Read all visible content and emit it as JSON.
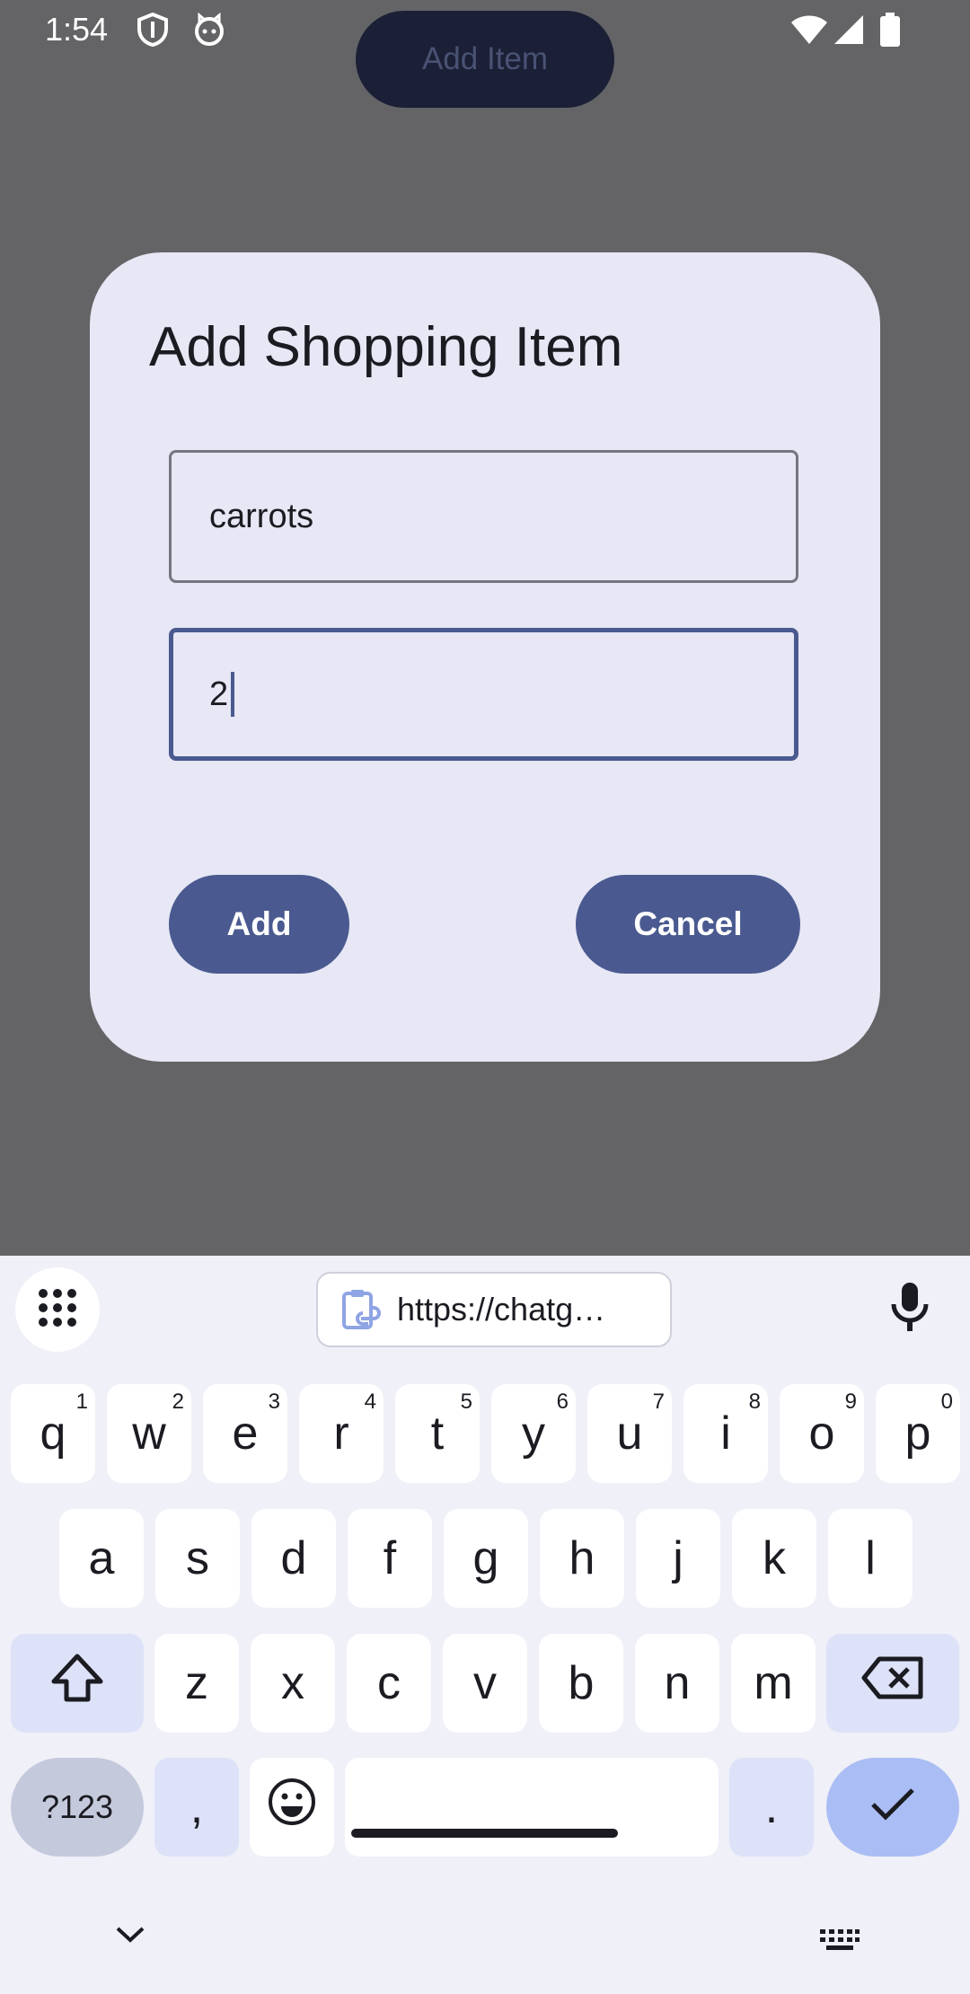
{
  "status_bar": {
    "time": "1:54",
    "icons": [
      "shield-icon",
      "cat-icon",
      "wifi-icon",
      "signal-icon",
      "battery-icon"
    ]
  },
  "background": {
    "add_item_button": "Add Item"
  },
  "dialog": {
    "title": "Add Shopping Item",
    "name_field_value": "carrots",
    "quantity_field_value": "2",
    "add_button": "Add",
    "cancel_button": "Cancel"
  },
  "keyboard": {
    "clipboard_suggestion": "https://chatg…",
    "row1": [
      {
        "key": "q",
        "hint": "1"
      },
      {
        "key": "w",
        "hint": "2"
      },
      {
        "key": "e",
        "hint": "3"
      },
      {
        "key": "r",
        "hint": "4"
      },
      {
        "key": "t",
        "hint": "5"
      },
      {
        "key": "y",
        "hint": "6"
      },
      {
        "key": "u",
        "hint": "7"
      },
      {
        "key": "i",
        "hint": "8"
      },
      {
        "key": "o",
        "hint": "9"
      },
      {
        "key": "p",
        "hint": "0"
      }
    ],
    "row2": [
      "a",
      "s",
      "d",
      "f",
      "g",
      "h",
      "j",
      "k",
      "l"
    ],
    "row3": [
      "z",
      "x",
      "c",
      "v",
      "b",
      "n",
      "m"
    ],
    "symbols_key": "?123",
    "comma_key": ",",
    "period_key": "."
  },
  "colors": {
    "scrim": "#646467",
    "dialog_bg": "#e7e7f5",
    "accent": "#4a5a90",
    "enter_key": "#aabdf4"
  }
}
